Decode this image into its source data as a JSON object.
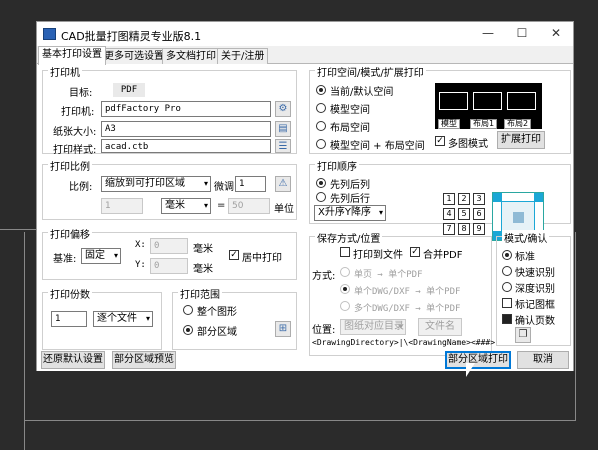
{
  "window": {
    "title": "CAD批量打图精灵专业版8.1",
    "minimize": "—",
    "maximize": "☐",
    "close": "✕"
  },
  "tabs": [
    "基本打印设置",
    "更多可选设置",
    "多文档打印",
    "关于/注册"
  ],
  "printer_group": {
    "title": "打印机",
    "target_label": "目标:",
    "target_value": "PDF",
    "printer_label": "打印机:",
    "printer_value": "pdfFactory Pro",
    "paper_label": "纸张大小:",
    "paper_value": "A3",
    "style_label": "打印样式:",
    "style_value": "acad.ctb"
  },
  "scale_group": {
    "title": "打印比例",
    "ratio_label": "比例:",
    "ratio_value": "缩放到可打印区域",
    "fine_label": "微调",
    "fine_value": "1",
    "left_value": "1",
    "unit_value": "毫米",
    "equals": "=",
    "right_value": "50",
    "unit_label": "单位"
  },
  "offset_group": {
    "title": "打印偏移",
    "base_label": "基准:",
    "base_value": "固定",
    "x_label": "X:",
    "x_value": "0",
    "x_unit": "毫米",
    "y_label": "Y:",
    "y_value": "0",
    "y_unit": "毫米",
    "center_label": "居中打印",
    "center_checked": true
  },
  "copies_group": {
    "title": "打印份数",
    "copies_value": "1",
    "mode_value": "逐个文件"
  },
  "range_group": {
    "title": "打印范围",
    "whole": "整个图形",
    "partial": "部分区域",
    "selected": "partial"
  },
  "space_group": {
    "title": "打印空间/模式/扩展打印",
    "options": [
      "当前/默认空间",
      "模型空间",
      "布局空间",
      "模型空间 + 布局空间"
    ],
    "selected": 0,
    "preview_tabs": [
      "模型",
      "布局1",
      "布局2"
    ],
    "multi_label": "多图模式",
    "multi_checked": true,
    "ext_button": "扩展打印"
  },
  "order_group": {
    "title": "打印顺序",
    "options": [
      "先列后列",
      "先列后行"
    ],
    "selected": 0,
    "sort_value": "X升序Y降序",
    "grid": [
      "1",
      "2",
      "3",
      "4",
      "5",
      "6",
      "7",
      "8",
      "9"
    ]
  },
  "save_group": {
    "title": "保存方式/位置",
    "print_to_file": "打印到文件",
    "merge_pdf": "合并PDF",
    "merge_checked": true,
    "mode_label": "方式:",
    "modes": [
      "单页 → 单个PDF",
      "单个DWG/DXF → 单个PDF",
      "多个DWG/DXF → 单个PDF"
    ],
    "location_label": "位置:",
    "location_value": "图纸对应目录",
    "filename_button": "文件名",
    "path": "<DrawingDirectory>|\\<DrawingName><###>"
  },
  "mode_group": {
    "title": "模式/确认",
    "options": [
      "标准",
      "快速识别",
      "深度识别"
    ],
    "selected": 0,
    "mark_frame": "标记图框",
    "confirm_pages": "确认页数",
    "confirm_checked": true
  },
  "bottom": {
    "restore": "还原默认设置",
    "preview": "部分区域预览",
    "print": "部分区域打印",
    "cancel": "取消"
  }
}
